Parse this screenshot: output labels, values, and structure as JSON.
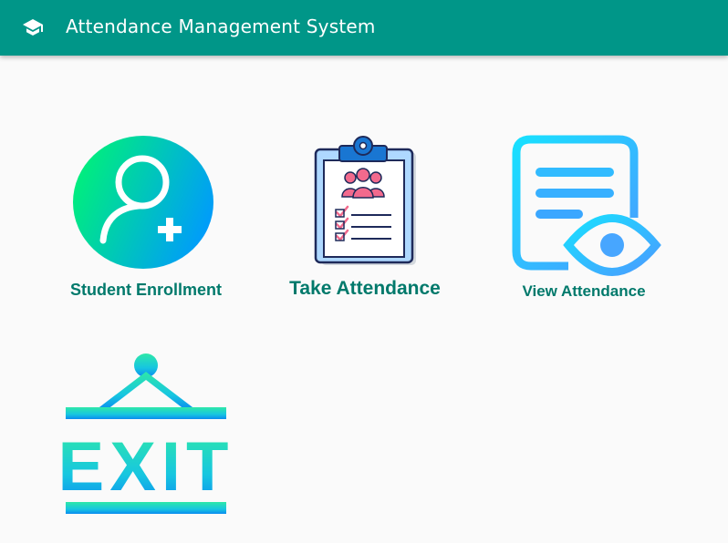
{
  "appbar": {
    "title": "Attendance Management System",
    "icon": "graduation-cap-icon",
    "background": "#009688"
  },
  "menu": {
    "enroll": {
      "label": "Student Enrollment",
      "icon": "add-user-icon"
    },
    "take": {
      "label": "Take Attendance",
      "icon": "clipboard-icon"
    },
    "view": {
      "label": "View Attendance",
      "icon": "document-eye-icon"
    },
    "exit": {
      "label": "EXIT",
      "icon": "exit-sign-icon"
    }
  },
  "colors": {
    "label": "#00796b",
    "accent_green": "#00e676",
    "accent_blue": "#00b0ff"
  }
}
